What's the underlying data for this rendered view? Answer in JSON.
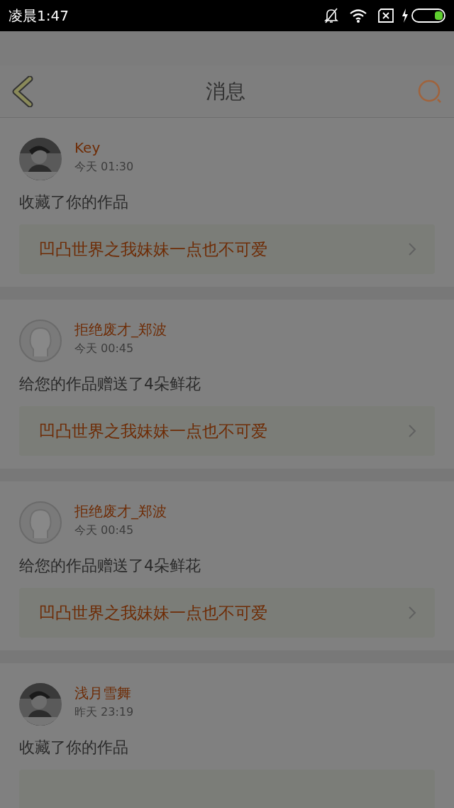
{
  "status_bar": {
    "time": "凌晨1:47"
  },
  "header": {
    "title": "消息"
  },
  "messages": [
    {
      "name": "Key",
      "time": "今天 01:30",
      "text": "收藏了你的作品",
      "work": "凹凸世界之我妹妹一点也不可爱"
    },
    {
      "kind": "placeholder",
      "name": "拒绝废才_郑波",
      "time": "今天 00:45",
      "text": "给您的作品赠送了4朵鲜花",
      "work": "凹凸世界之我妹妹一点也不可爱"
    },
    {
      "kind": "placeholder",
      "name": "拒绝废才_郑波",
      "time": "今天 00:45",
      "text": "给您的作品赠送了4朵鲜花",
      "work": "凹凸世界之我妹妹一点也不可爱"
    },
    {
      "name": "浅月雪舞",
      "time": "昨天 23:19",
      "text": "收藏了你的作品"
    }
  ]
}
